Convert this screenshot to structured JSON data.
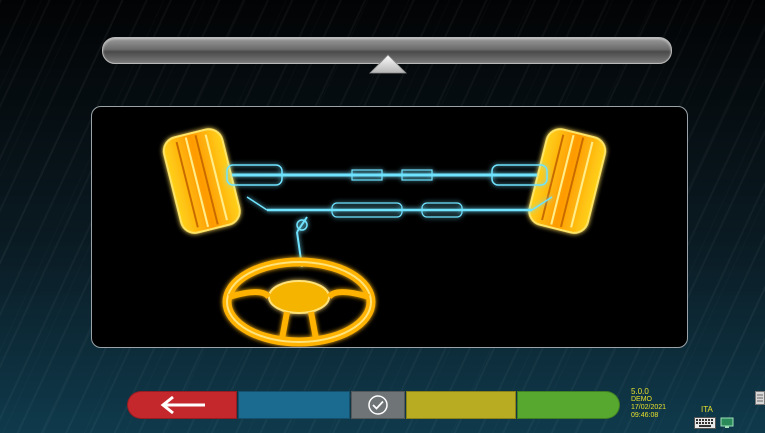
{
  "bottom_bar": {
    "buttons": [
      {
        "name": "back",
        "color": "#c4272c",
        "icon": "arrow-left-icon"
      },
      {
        "name": "blue",
        "color": "#1b6b90"
      },
      {
        "name": "confirm",
        "color": "#6f7477",
        "icon": "check-circle-icon"
      },
      {
        "name": "yellow",
        "color": "#b8ad22"
      },
      {
        "name": "green",
        "color": "#56a82f"
      }
    ]
  },
  "status": {
    "version": "5.0.0",
    "mode": "DEMO",
    "date": "17/02/2021",
    "time": "09:46:08",
    "language": "ITA"
  },
  "icons": {
    "top": "triangle-up-icon",
    "keyboard": "keyboard-icon",
    "network": "network-icon",
    "document": "document-icon"
  }
}
